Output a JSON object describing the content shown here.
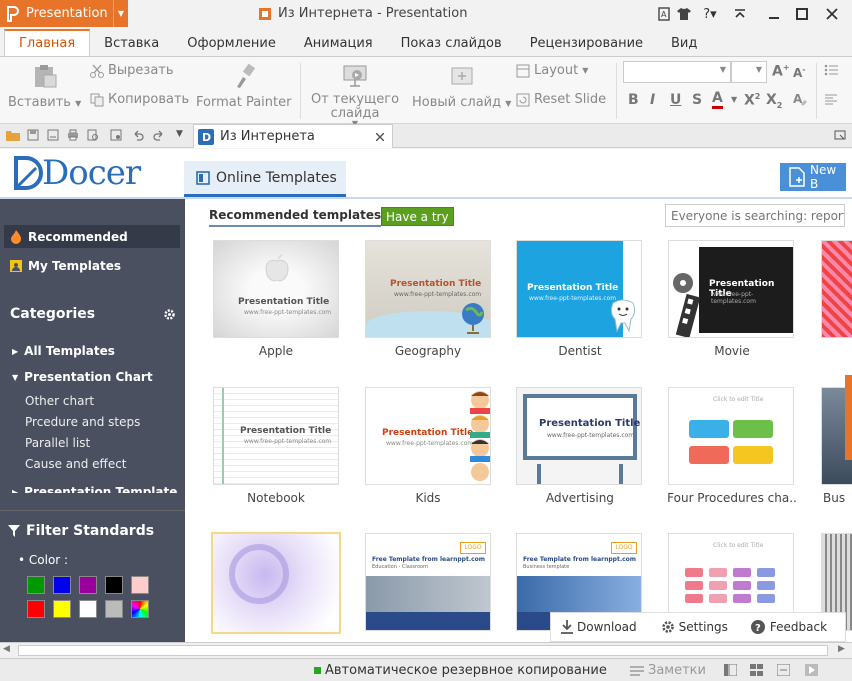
{
  "app": {
    "button_label": "Presentation",
    "window_title": "Из Интернета - Presentation"
  },
  "menu_tabs": [
    "Главная",
    "Вставка",
    "Оформление",
    "Анимация",
    "Показ слайдов",
    "Рецензирование",
    "Вид"
  ],
  "ribbon": {
    "paste": "Вставить",
    "cut": "Вырезать",
    "copy": "Копировать",
    "format_painter": "Format Painter",
    "from_current": "От текущего слайда",
    "new_slide": "Новый слайд",
    "layout": "Layout",
    "reset_slide": "Reset Slide"
  },
  "doc_tab": {
    "title": "Из Интернета"
  },
  "docer": {
    "logo": "Docer",
    "online_templates": "Online Templates",
    "new_button": "New B"
  },
  "sidebar": {
    "recommended": "Recommended",
    "my_templates": "My Templates",
    "categories_title": "Categories",
    "categories": [
      {
        "label": "All Templates",
        "expanded": false
      },
      {
        "label": "Presentation Chart",
        "expanded": true
      },
      {
        "label": "Presentation Template",
        "expanded": false
      }
    ],
    "subcategories": [
      "Other chart",
      "Prcedure and steps",
      "Parallel list",
      "Cause and effect"
    ],
    "filter_title": "Filter Standards",
    "color_label": "Color :",
    "colors": [
      "#009900",
      "#0000ee",
      "#990099",
      "#000000",
      "#ffcccc",
      "#ff0000",
      "#ffff00",
      "#ffffff",
      "#bbbbbb",
      "rainbow"
    ]
  },
  "main": {
    "recommended_tab": "Recommended templates",
    "have_a_try": "Have a try",
    "search_placeholder": "Everyone is searching: report",
    "templates": [
      {
        "name": "Apple",
        "thumb_title": "Presentation Title",
        "thumb_sub": "www.free-ppt-templates.com"
      },
      {
        "name": "Geography",
        "thumb_title": "Presentation Title",
        "thumb_sub": "www.free-ppt-templates.com"
      },
      {
        "name": "Dentist",
        "thumb_title": "Presentation Title",
        "thumb_sub": "www.free-ppt-templates.com"
      },
      {
        "name": "Movie",
        "thumb_title": "Presentation Title",
        "thumb_sub": "www.free-ppt-templates.com"
      },
      {
        "name": "Notebook",
        "thumb_title": "Presentation Title",
        "thumb_sub": "www.free-ppt-templates.com"
      },
      {
        "name": "Kids",
        "thumb_title": "Presentation Title",
        "thumb_sub": "www.free-ppt-templates.com"
      },
      {
        "name": "Advertising",
        "thumb_title": "Presentation Title",
        "thumb_sub": "www.free-ppt-templates.com"
      },
      {
        "name": "Four Procedures cha..",
        "thumb_title": "Click to edit Title",
        "thumb_sub": ""
      },
      {
        "name": "Bus",
        "thumb_title": "",
        "thumb_sub": ""
      },
      {
        "name": "",
        "thumb_title": "",
        "thumb_sub": ""
      },
      {
        "name": "",
        "thumb_title": "Free Template from learnppt.com",
        "thumb_sub": "Education - Classroom"
      },
      {
        "name": "",
        "thumb_title": "Free Template from learnppt.com",
        "thumb_sub": "Business template"
      },
      {
        "name": "",
        "thumb_title": "Click to edit Title",
        "thumb_sub": ""
      }
    ],
    "logo_badge": "LOGO"
  },
  "bottom_bar": {
    "download": "Download",
    "settings": "Settings",
    "feedback": "Feedback"
  },
  "status": {
    "backup": "Автоматическое резервное копирование",
    "notes": "Заметки"
  }
}
